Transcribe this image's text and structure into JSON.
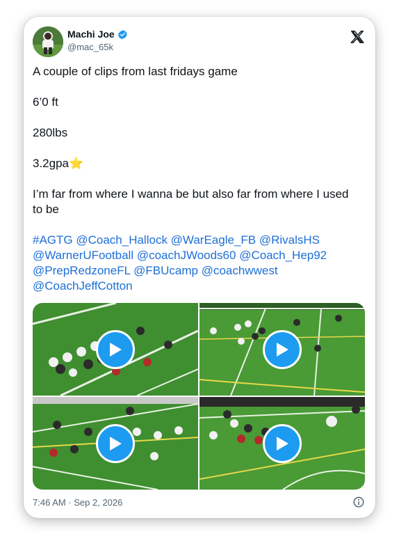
{
  "author": {
    "name": "Machi Joe",
    "handle": "@mac_65k",
    "verified_color": "#1d9bf0",
    "avatar_icon": "avatar-football-player"
  },
  "brand_icon": "x-logo-icon",
  "post": {
    "line1": "A couple of clips from last fridays game",
    "line2": "6’0 ft",
    "line3": "280lbs",
    "line4_text": "3.2gpa",
    "line4_emoji": "⭐",
    "line5": "I’m far from where I wanna be but also far from where I used to be",
    "hashtags": "#AGTG @Coach_Hallock @WarEagle_FB @RivalsHS @WarnerUFootball @coachJWoods60 @Coach_Hep92 @PrepRedzoneFL @FBUcamp @coachwwest @CoachJeffCotton"
  },
  "media": {
    "count": 4,
    "clips": [
      "video-1",
      "video-2",
      "video-3",
      "video-4"
    ],
    "play_color": "#1d9bf0"
  },
  "footer": {
    "timestamp": "7:46 AM · Sep 2, 2026",
    "info_icon": "info-icon"
  },
  "colors": {
    "text": "#0f1419",
    "muted": "#536471",
    "link": "#1d6fd6",
    "field_green": "#3c8a2e"
  }
}
